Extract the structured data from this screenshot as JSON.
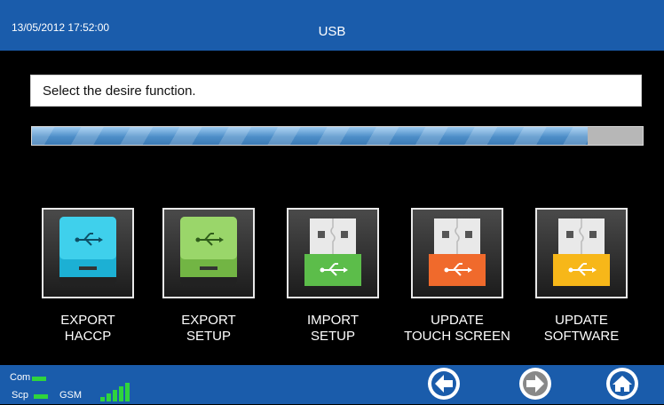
{
  "header": {
    "datetime": "13/05/2012 17:52:00",
    "title": "USB"
  },
  "message": {
    "text": "Select the desire function."
  },
  "progress": {
    "fraction": 0.91
  },
  "functions": [
    {
      "line1": "EXPORT",
      "line2": "HACCP",
      "icon": "usb-drive-cyan-icon",
      "color": "#22b8d8"
    },
    {
      "line1": "EXPORT",
      "line2": "SETUP",
      "icon": "usb-drive-green-icon",
      "color": "#7fc04c"
    },
    {
      "line1": "IMPORT",
      "line2": "SETUP",
      "icon": "usb-stick-green-icon",
      "color": "#5cbd4a"
    },
    {
      "line1": "UPDATE",
      "line2": "TOUCH SCREEN",
      "icon": "usb-stick-orange-icon",
      "color": "#f06a2c"
    },
    {
      "line1": "UPDATE",
      "line2": "SOFTWARE",
      "icon": "usb-stick-yellow-icon",
      "color": "#f7b719"
    }
  ],
  "status": {
    "com_label": "Com",
    "scp_label": "Scp",
    "gsm_label": "GSM",
    "led_color": "#2fd43c"
  },
  "nav": {
    "back_icon": "arrow-left-icon",
    "forward_icon": "arrow-right-icon",
    "home_icon": "home-icon"
  }
}
